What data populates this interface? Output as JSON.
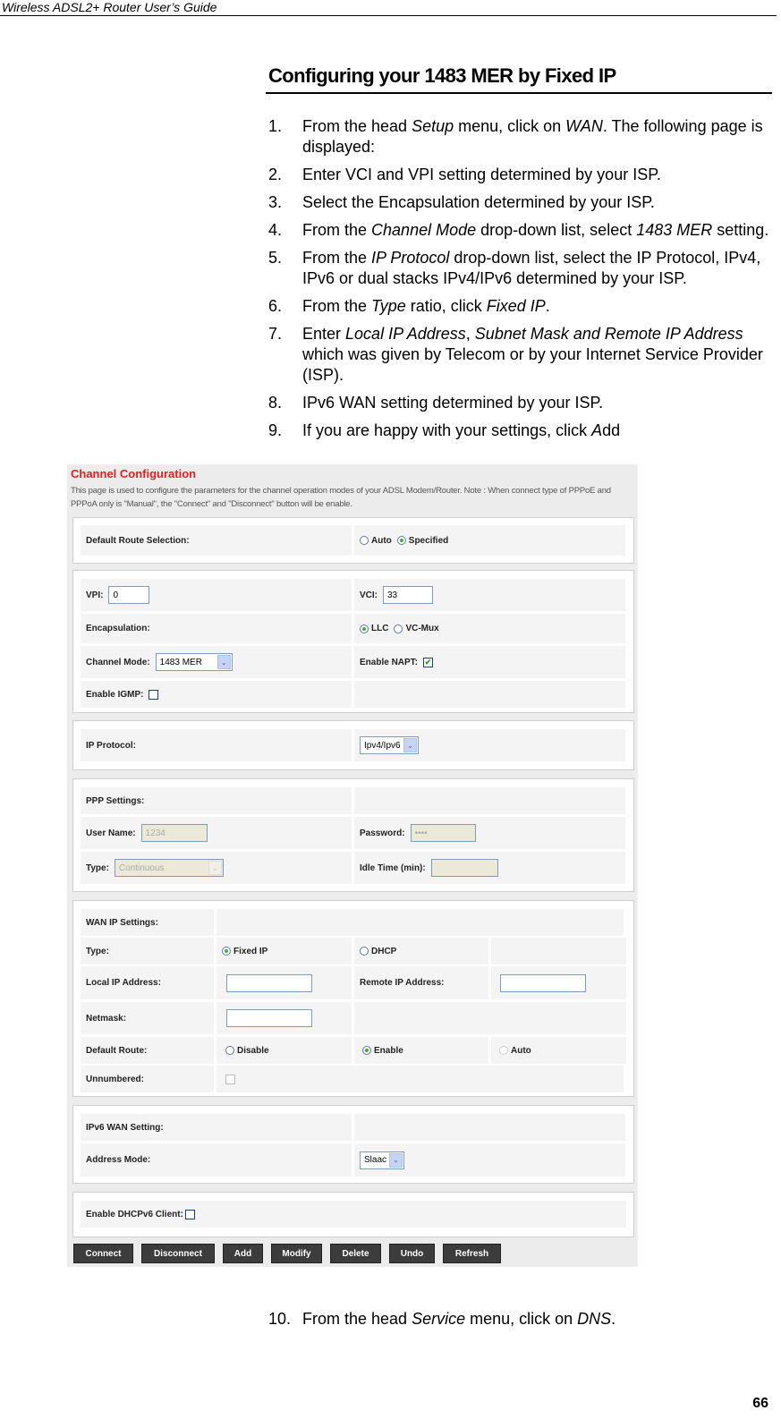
{
  "document": {
    "running_header": "Wireless ADSL2+ Router User’s Guide",
    "section_title": "Configuring your 1483 MER by Fixed IP",
    "page_number": "66"
  },
  "steps": [
    {
      "num": "1.",
      "parts": [
        {
          "t": "From the head "
        },
        {
          "t": "Setup",
          "i": true
        },
        {
          "t": " menu, click on "
        },
        {
          "t": "WAN",
          "i": true
        },
        {
          "t": ". The following page is displayed:"
        }
      ]
    },
    {
      "num": "2.",
      "parts": [
        {
          "t": "Enter VCI and VPI setting determined by your ISP."
        }
      ]
    },
    {
      "num": "3.",
      "parts": [
        {
          "t": "Select the Encapsulation determined by your ISP."
        }
      ]
    },
    {
      "num": "4.",
      "parts": [
        {
          "t": "From the "
        },
        {
          "t": "Channel Mode",
          "i": true
        },
        {
          "t": " drop-down list, select "
        },
        {
          "t": "1483 MER",
          "i": true
        },
        {
          "t": " setting."
        }
      ]
    },
    {
      "num": "5.",
      "parts": [
        {
          "t": "From the "
        },
        {
          "t": "IP Protocol",
          "i": true
        },
        {
          "t": " drop-down list, select the IP Protocol, IPv4, IPv6 or dual stacks IPv4/IPv6 determined by your ISP."
        }
      ]
    },
    {
      "num": "6.",
      "parts": [
        {
          "t": "From the "
        },
        {
          "t": "Type",
          "i": true
        },
        {
          "t": " ratio, click "
        },
        {
          "t": "Fixed IP",
          "i": true
        },
        {
          "t": "."
        }
      ]
    },
    {
      "num": "7.",
      "parts": [
        {
          "t": "Enter "
        },
        {
          "t": "Local IP Address",
          "i": true
        },
        {
          "t": ", "
        },
        {
          "t": "Subnet Mask and Remote IP Address",
          "i": true
        },
        {
          "t": " which was given by Telecom or by your Internet Service Provider (ISP)."
        }
      ]
    },
    {
      "num": "8.",
      "parts": [
        {
          "t": "IPv6 WAN setting determined by your ISP."
        }
      ]
    },
    {
      "num": "9.",
      "parts": [
        {
          "t": "If you are happy with your settings, click "
        },
        {
          "t": "A",
          "i": true
        },
        {
          "t": "dd"
        }
      ]
    }
  ],
  "step10": {
    "num": "10.",
    "parts": [
      {
        "t": "From the head "
      },
      {
        "t": "Service",
        "i": true
      },
      {
        "t": " menu, click on "
      },
      {
        "t": "DNS",
        "i": true
      },
      {
        "t": "."
      }
    ]
  },
  "router_ui": {
    "title": "Channel Configuration",
    "description": "This page is used to configure the parameters for the channel operation modes of your ADSL Modem/Router. Note : When connect type of PPPoE and PPPoA only is \"Manual\", the \"Connect\" and \"Disconnect\" button will be enable.",
    "colors": {
      "title": "#e02020",
      "radio_checked": "#3cb030",
      "button_bg": "#3c3c3c"
    },
    "default_route_selection": {
      "label": "Default Route Selection:",
      "options": [
        "Auto",
        "Specified"
      ],
      "selected": "Specified"
    },
    "vpi": {
      "label": "VPI:",
      "value": "0"
    },
    "vci": {
      "label": "VCI:",
      "value": "33"
    },
    "encapsulation": {
      "label": "Encapsulation:",
      "options": [
        "LLC",
        "VC-Mux"
      ],
      "selected": "LLC"
    },
    "channel_mode": {
      "label": "Channel Mode:",
      "value": "1483 MER"
    },
    "enable_napt": {
      "label": "Enable NAPT:",
      "checked": true
    },
    "enable_igmp": {
      "label": "Enable IGMP:",
      "checked": false
    },
    "ip_protocol": {
      "label": "IP Protocol:",
      "value": "Ipv4/Ipv6"
    },
    "ppp": {
      "heading": "PPP Settings:",
      "user_name": {
        "label": "User Name:",
        "value": "1234"
      },
      "password": {
        "label": "Password:",
        "value": "••••"
      },
      "type": {
        "label": "Type:",
        "value": "Continuous"
      },
      "idle_time": {
        "label": "Idle Time (min):",
        "value": ""
      }
    },
    "wan_ip": {
      "heading": "WAN IP Settings:",
      "type": {
        "label": "Type:",
        "options": [
          "Fixed IP",
          "DHCP"
        ],
        "selected": "Fixed IP"
      },
      "local_ip": {
        "label": "Local IP Address:",
        "value": ""
      },
      "remote_ip": {
        "label": "Remote IP Address:",
        "value": ""
      },
      "netmask": {
        "label": "Netmask:",
        "value": ""
      },
      "default_route": {
        "label": "Default Route:",
        "options": [
          "Disable",
          "Enable",
          "Auto"
        ],
        "selected": "Enable"
      },
      "unnumbered": {
        "label": "Unnumbered:",
        "checked": false
      }
    },
    "ipv6_wan": {
      "heading": "IPv6 WAN Setting:",
      "address_mode": {
        "label": "Address Mode:",
        "value": "Slaac"
      }
    },
    "dhcpv6_client": {
      "label": "Enable DHCPv6 Client:",
      "checked": false
    },
    "buttons": [
      "Connect",
      "Disconnect",
      "Add",
      "Modify",
      "Delete",
      "Undo",
      "Refresh"
    ],
    "icons": {
      "select_arrow": "chevron-down-icon",
      "checkmark": "✔"
    }
  }
}
